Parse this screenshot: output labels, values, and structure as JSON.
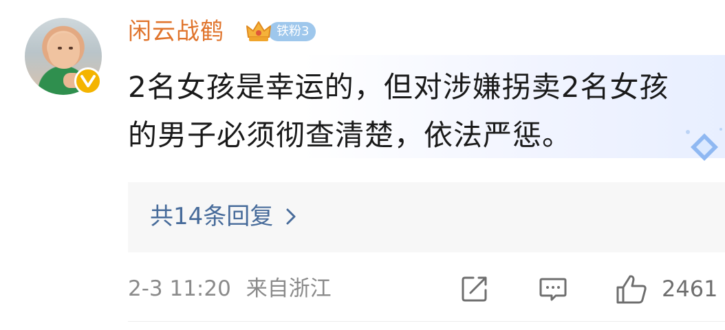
{
  "comment": {
    "username": "闲云战鹤",
    "fan_badge": {
      "label": "铁粉3",
      "icon": "crown-icon",
      "color": "#9ec7ec"
    },
    "verified_icon": "verified-v-icon",
    "text": "2名女孩是幸运的，但对涉嫌拐卖2名女孩的男子必须彻查清楚，依法严惩。",
    "replies_label": "共14条回复",
    "timestamp": "2-3 11:20",
    "location": "来自浙江",
    "like_count": "2461"
  },
  "colors": {
    "username": "#e0742c",
    "link": "#476b9a",
    "meta": "#8a8a8a",
    "verified": "#f4b400"
  }
}
